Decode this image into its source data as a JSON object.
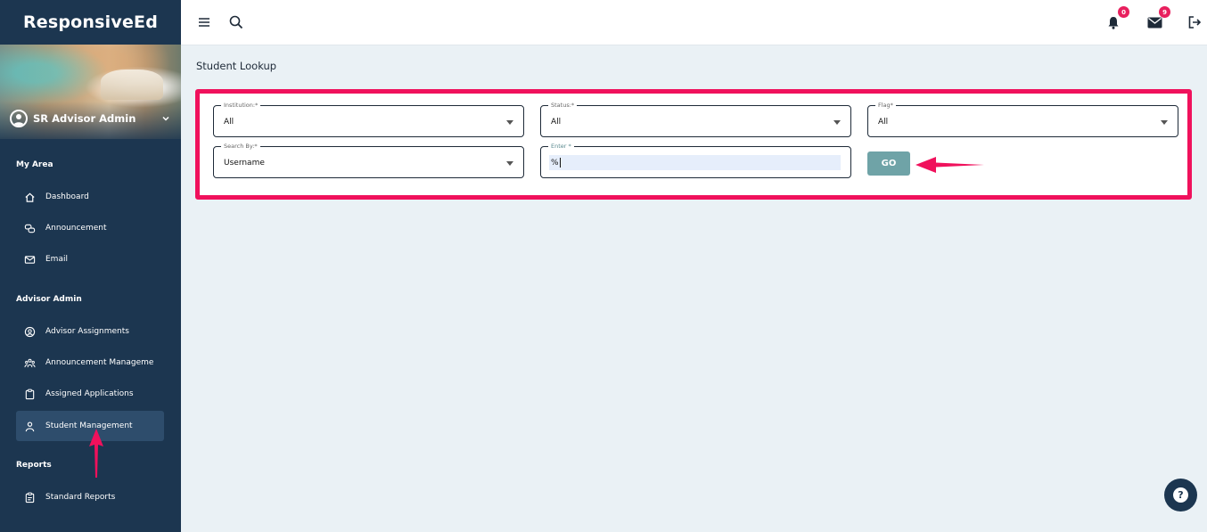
{
  "app": {
    "brand": "ResponsiveEd"
  },
  "sidebar": {
    "user_name": "SR Advisor Admin",
    "sections": [
      {
        "title": "My Area"
      },
      {
        "title": "Advisor Admin"
      },
      {
        "title": "Reports"
      }
    ],
    "items": [
      {
        "label": "Dashboard",
        "icon": "home-icon"
      },
      {
        "label": "Announcement",
        "icon": "chat-bubbles-icon"
      },
      {
        "label": "Email",
        "icon": "mail-icon"
      },
      {
        "label": "Advisor Assignments",
        "icon": "user-circle-icon"
      },
      {
        "label": "Announcement Manageme",
        "icon": "group-icon"
      },
      {
        "label": "Assigned Applications",
        "icon": "clipboard-icon"
      },
      {
        "label": "Student Management",
        "icon": "user-icon",
        "active": true
      },
      {
        "label": "Standard Reports",
        "icon": "report-clipboard-icon"
      }
    ]
  },
  "topbar": {
    "notifications_count": "0",
    "messages_count": "9"
  },
  "main": {
    "page_title": "Student Lookup",
    "filters": {
      "institution": {
        "label": "Institution:*",
        "value": "All"
      },
      "status": {
        "label": "Status:*",
        "value": "All"
      },
      "flag": {
        "label": "Flag*",
        "value": "All"
      },
      "search_by": {
        "label": "Search By:*",
        "value": "Username"
      },
      "enter": {
        "label": "Enter *",
        "value": "%"
      }
    },
    "go_label": "GO"
  },
  "colors": {
    "sidebar_bg": "#1c3650",
    "highlight_border": "#f0115c",
    "go_button": "#6fa3a7",
    "badge": "#e8205e",
    "annotation_arrow": "#f0115c"
  }
}
